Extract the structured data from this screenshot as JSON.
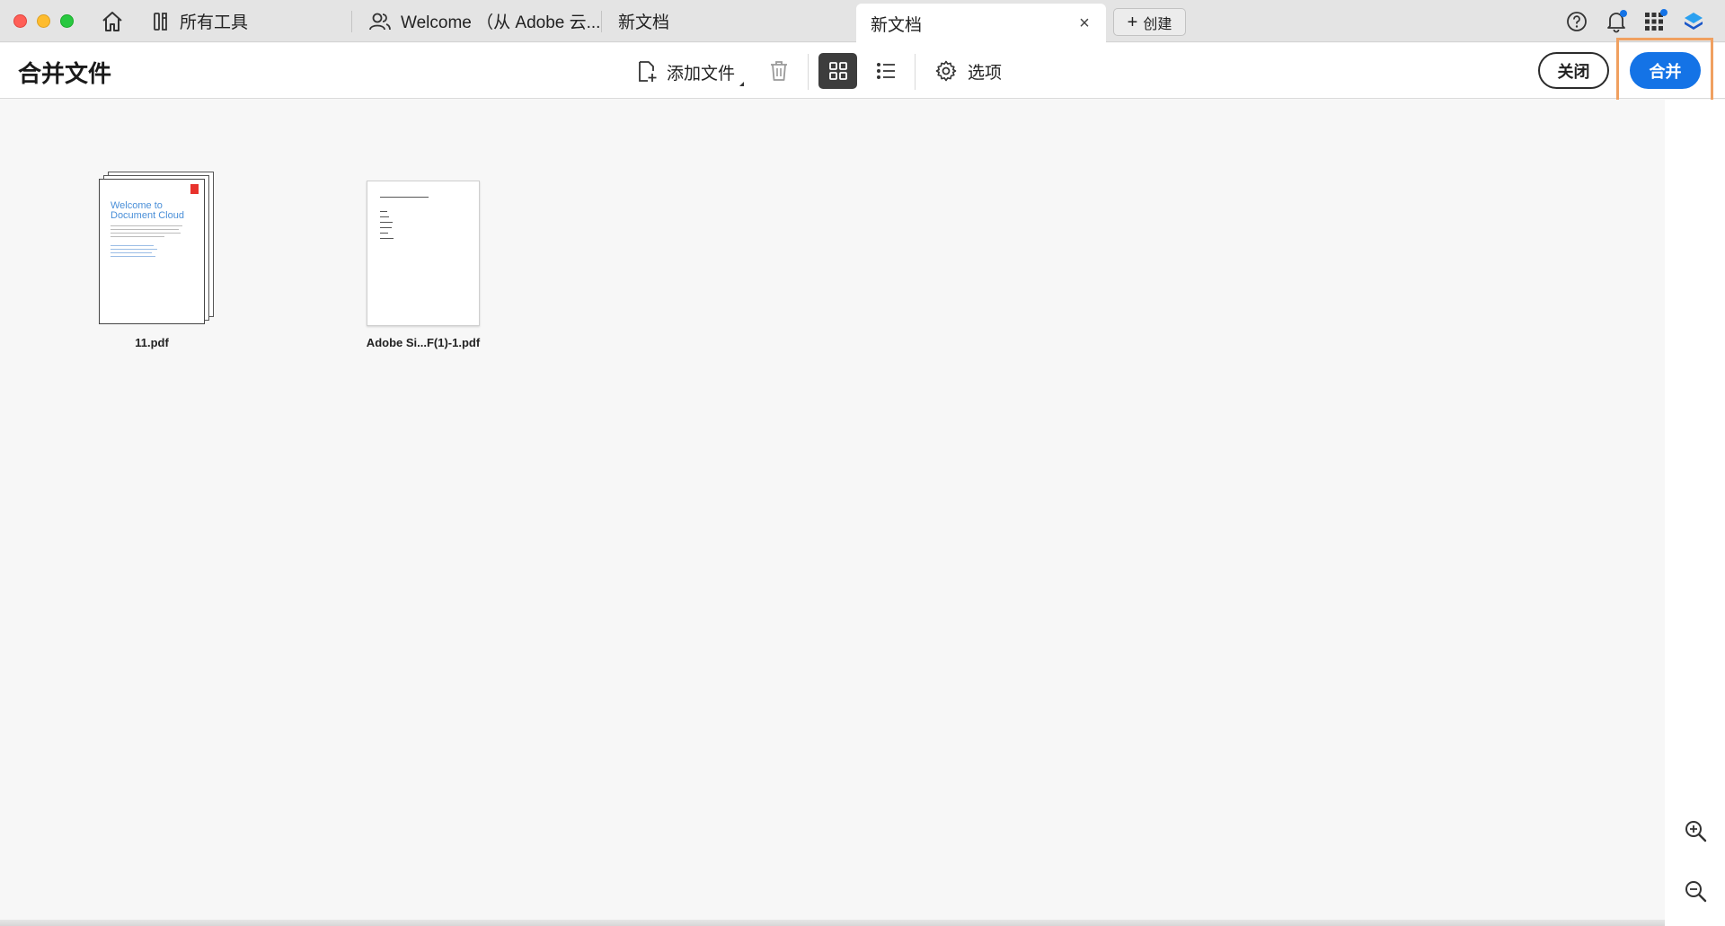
{
  "tabs": {
    "tools_label": "所有工具",
    "welcome_label": "Welcome （从 Adobe 云...",
    "new_doc_1": "新文档",
    "new_doc_2": "新文档",
    "close_glyph": "×",
    "create_label": "创建"
  },
  "toolbar": {
    "title": "合并文件",
    "add_files_label": "添加文件",
    "options_label": "选项",
    "close_label": "关闭",
    "merge_label": "合并"
  },
  "files": [
    {
      "name": "11.pdf"
    },
    {
      "name": "Adobe Si...F(1)-1.pdf"
    }
  ],
  "thumb1": {
    "line1": "Welcome to",
    "line2": "Document Cloud"
  },
  "colors": {
    "accent": "#1473e6",
    "highlight": "#f0a060"
  }
}
